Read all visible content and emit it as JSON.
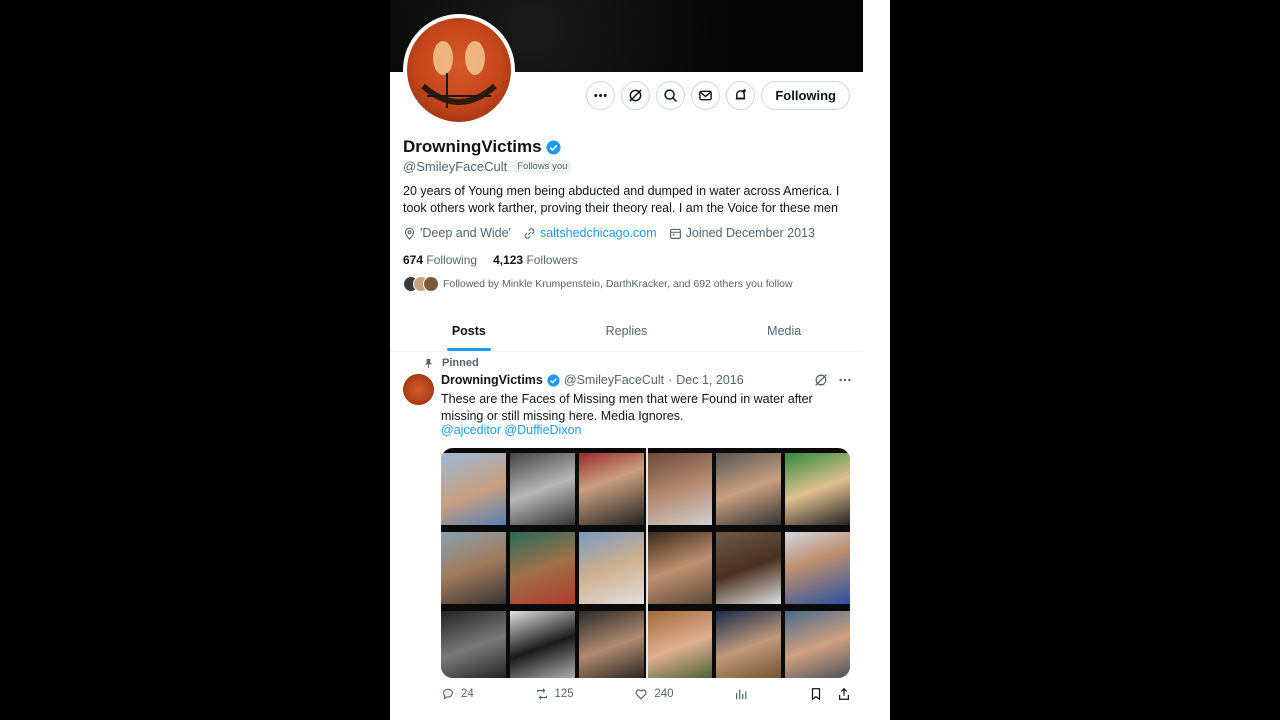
{
  "profile": {
    "display_name": "DrowningVictims",
    "handle": "@SmileyFaceCult",
    "follows_you": "Follows you",
    "bio": "20 years of Young men being abducted and dumped in water across America. I took others work farther, proving their theory real. I am the Voice for these men",
    "location": "'Deep and Wide'",
    "website": "saltshedchicago.com",
    "joined": "Joined December 2013",
    "following_count": "674",
    "following_label": "Following",
    "followers_count": "4,123",
    "followers_label": "Followers",
    "followed_by": "Followed by Minkle Krumpenstein, DarthKracker, and 692 others you follow"
  },
  "actions": {
    "follow_label": "Following"
  },
  "tabs": [
    {
      "label": "Posts"
    },
    {
      "label": "Replies"
    },
    {
      "label": "Media"
    }
  ],
  "post": {
    "pinned_label": "Pinned",
    "name": "DrowningVictims",
    "handle": "@SmileyFaceCult",
    "separator": "·",
    "date": "Dec 1, 2016",
    "text": "These are the Faces of Missing men that were Found in water after missing or still missing here. Media Ignores.",
    "mentions": "@ajceditor @DuffieDixon",
    "replies": "24",
    "reposts": "125",
    "likes": "240"
  },
  "colors": {
    "accent": "#1d9bf0",
    "text": "#0f1419",
    "muted": "#536471",
    "border": "#cfd9de"
  }
}
